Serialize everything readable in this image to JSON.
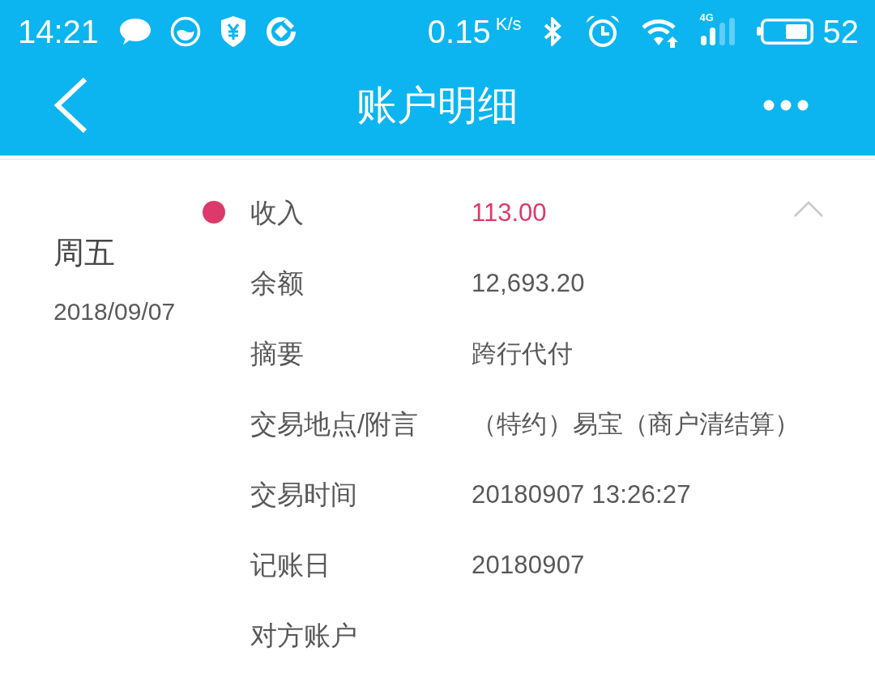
{
  "status_bar": {
    "time": "14:21",
    "net_speed": "0.15",
    "net_speed_unit": "K/s",
    "network_type": "4G",
    "battery": "52"
  },
  "app_bar": {
    "title": "账户明细"
  },
  "transactions": [
    {
      "weekday": "周五",
      "date": "2018/09/07",
      "color": "#dc3a6a",
      "expanded": true,
      "fields": [
        {
          "kind": "amount",
          "label": "收入",
          "value": "113.00"
        },
        {
          "kind": "text",
          "label": "余额",
          "value": "12,693.20"
        },
        {
          "kind": "text",
          "label": "摘要",
          "value": "跨行代付"
        },
        {
          "kind": "text",
          "label": "交易地点/附言",
          "value": "（特约）易宝（商户清结算）"
        },
        {
          "kind": "text",
          "label": "交易时间",
          "value": "20180907 13:26:27"
        },
        {
          "kind": "text",
          "label": "记账日",
          "value": "20180907"
        },
        {
          "kind": "text",
          "label": "对方账户"
        }
      ]
    }
  ]
}
